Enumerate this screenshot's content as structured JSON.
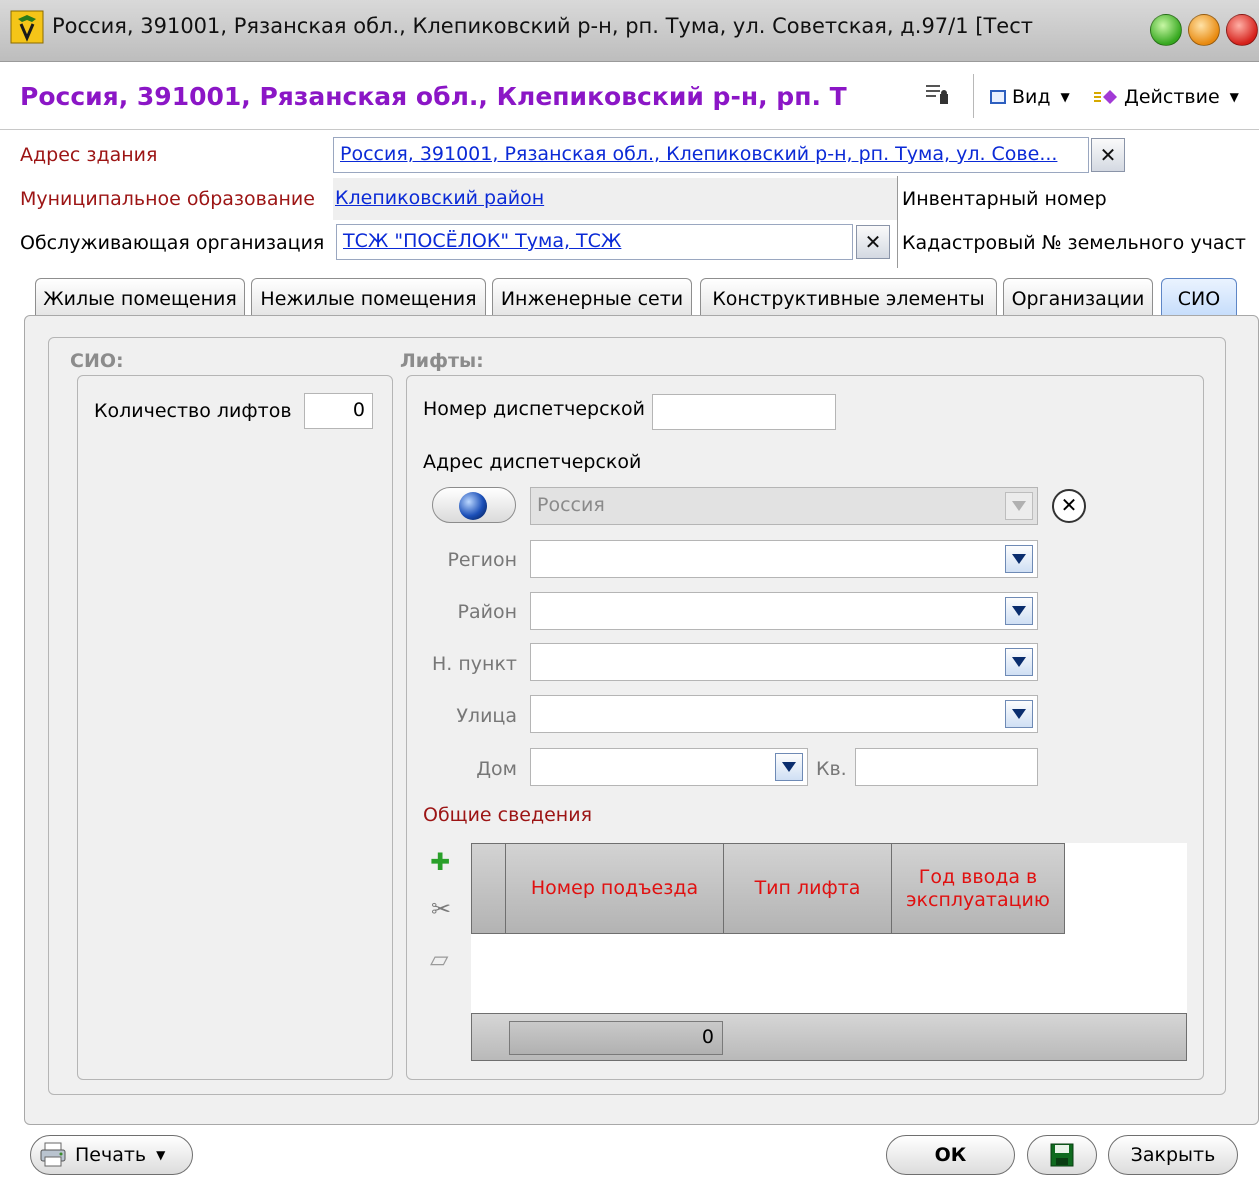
{
  "window": {
    "title": "Россия, 391001, Рязанская обл., Клепиковский р-н, рп. Тума, ул. Советская, д.97/1 [Тест"
  },
  "header": {
    "title": "Россия, 391001, Рязанская обл., Клепиковский р-н, рп. Т",
    "view_label": "Вид",
    "action_label": "Действие"
  },
  "form": {
    "building_address_label": "Адрес здания",
    "building_address_value": "Россия, 391001, Рязанская обл., Клепиковский р-н, рп. Тума, ул. Сове...",
    "municipality_label": "Муниципальное образование",
    "municipality_value": "Клепиковский район",
    "service_org_label": "Обслуживающая организация",
    "service_org_value": "ТСЖ \"ПОСЁЛОК\" Тума, ТСЖ",
    "inventory_label": "Инвентарный номер",
    "cadastral_label": "Кадастровый № земельного участ",
    "clear_glyph": "✕"
  },
  "tabs": [
    {
      "label": "Жилые помещения"
    },
    {
      "label": "Нежилые помещения"
    },
    {
      "label": "Инженерные сети"
    },
    {
      "label": "Конструктивные элементы"
    },
    {
      "label": "Организации"
    },
    {
      "label": "СИО",
      "active": true
    }
  ],
  "sio": {
    "group_title": "СИО:",
    "lift_count_label": "Количество лифтов",
    "lift_count_value": "0"
  },
  "lifts": {
    "group_title": "Лифты:",
    "dispatch_number_label": "Номер диспетчерской",
    "dispatch_number_value": "",
    "dispatch_address_label": "Адрес диспетчерской",
    "country_value": "Россия",
    "region_label": "Регион",
    "district_label": "Район",
    "locality_label": "Н. пункт",
    "street_label": "Улица",
    "house_label": "Дом",
    "apartment_label": "Кв.",
    "clear_glyph": "✕",
    "general_info_label": "Общие сведения",
    "grid": {
      "columns": [
        "Номер подъезда",
        "Тип лифта",
        "Год ввода в эксплуатацию"
      ],
      "rows": [],
      "footer_value": "0"
    }
  },
  "bottom": {
    "print_label": "Печать",
    "ok_label": "ОК",
    "close_label": "Закрыть"
  },
  "colors": {
    "title_purple": "#8b16c6",
    "label_red": "#9c1414",
    "link_blue": "#0b2ad6",
    "grid_header_red": "#e01010"
  },
  "icons": [
    "app-icon",
    "tools-icon",
    "view-icon",
    "action-icon",
    "globe-icon",
    "add-icon",
    "delete-icon",
    "edit-icon",
    "printer-icon",
    "save-icon"
  ]
}
